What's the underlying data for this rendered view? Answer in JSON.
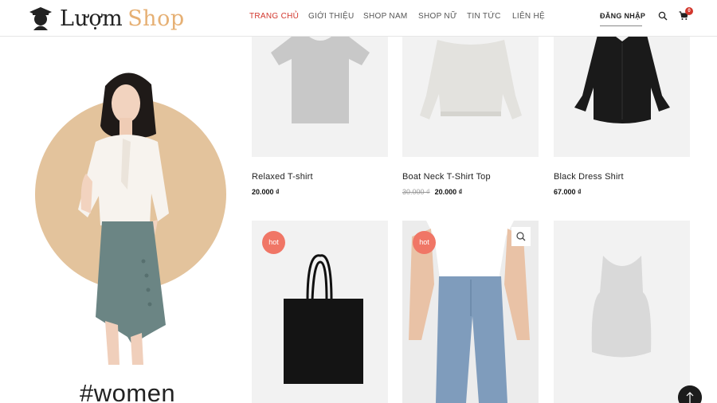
{
  "brand": {
    "name_part1": "Lượm",
    "name_part2": "Shop"
  },
  "nav": {
    "items": [
      {
        "label": "TRANG CHỦ",
        "active": true
      },
      {
        "label": "GIỚI THIỆU",
        "active": false
      },
      {
        "label": "SHOP NAM",
        "active": false
      },
      {
        "label": "SHOP NỮ",
        "active": false
      },
      {
        "label": "TIN TỨC",
        "active": false
      },
      {
        "label": "LIÊN HỆ",
        "active": false
      }
    ]
  },
  "account": {
    "login_label": "ĐĂNG NHẬP"
  },
  "cart": {
    "count": "0"
  },
  "hero": {
    "hashtag": "#women"
  },
  "products": [
    {
      "name": "Relaxed T-shirt",
      "price": "20.000 ₫",
      "old_price": "",
      "badge": ""
    },
    {
      "name": "Boat Neck T-Shirt Top",
      "price": "20.000 ₫",
      "old_price": "30.000 ₫",
      "badge": ""
    },
    {
      "name": "Black Dress Shirt",
      "price": "67.000 ₫",
      "old_price": "",
      "badge": ""
    },
    {
      "name": "",
      "price": "",
      "old_price": "",
      "badge": "hot"
    },
    {
      "name": "",
      "price": "",
      "old_price": "",
      "badge": "hot"
    },
    {
      "name": "",
      "price": "",
      "old_price": "",
      "badge": ""
    }
  ],
  "colors": {
    "accent": "#d2372d",
    "gold": "#e6b074",
    "hero_circle": "#e3c39c",
    "hot_badge": "#f07666",
    "thumb_bg": "#f2f2f2"
  },
  "icons": [
    "logo-mark-icon",
    "search-icon",
    "cart-icon",
    "zoom-icon",
    "arrow-up-icon"
  ]
}
